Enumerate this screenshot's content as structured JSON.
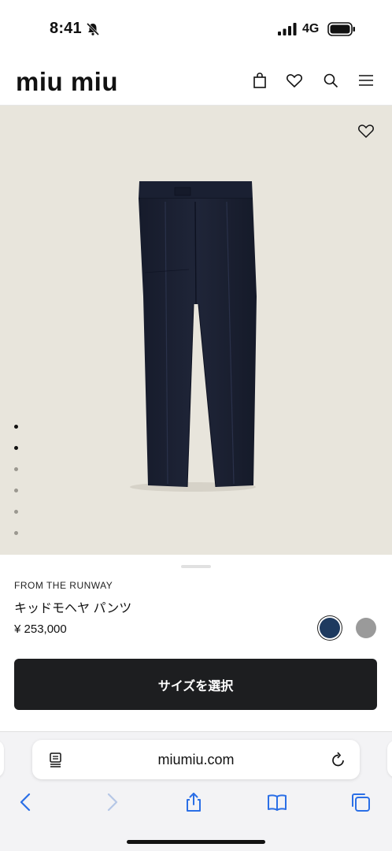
{
  "status": {
    "time": "8:41",
    "network": "4G"
  },
  "header": {
    "logo": "miu miu",
    "icons": [
      "bag-icon",
      "heart-icon",
      "search-icon",
      "menu-icon"
    ]
  },
  "hero": {
    "slides_total": 6,
    "active_slide_dots": [
      1,
      2
    ]
  },
  "product": {
    "eyebrow": "FROM THE RUNWAY",
    "name": "キッドモヘヤ パンツ",
    "price": "¥ 253,000",
    "swatches": [
      {
        "name": "navy",
        "color": "#1e3a5f",
        "selected": true
      },
      {
        "name": "grey",
        "color": "#9a9a9a",
        "selected": false
      }
    ],
    "cta_label": "サイズを選択"
  },
  "browser": {
    "url": "miumiu.com",
    "toolbar_icons": [
      "back-icon",
      "forward-icon",
      "share-icon",
      "bookmarks-icon",
      "tabs-icon"
    ]
  },
  "colors": {
    "accent": "#1d1e20",
    "hero_background": "#e8e5dc"
  }
}
